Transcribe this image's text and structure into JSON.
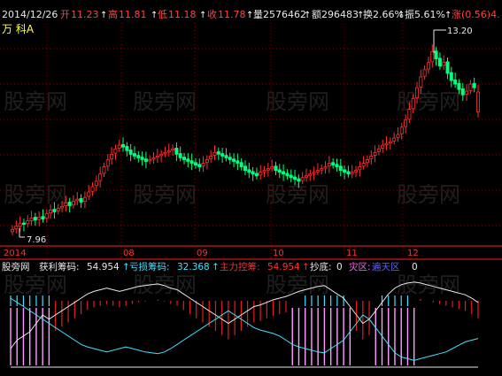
{
  "header": {
    "date": "2014/12/26",
    "open_label": "开",
    "open_value": "11.23",
    "high_label": "高",
    "high_value": "11.81",
    "low_label": "低",
    "low_value": "11.18",
    "close_label": "收",
    "close_value": "11.78",
    "volume_label": "量",
    "volume_value": "2576462",
    "amount_label": "额",
    "amount_value": "296483",
    "turnover_label": "换",
    "turnover_value": "2.66%",
    "amplitude_label": "振",
    "amplitude_value": "5.61%",
    "change_label": "涨",
    "change_value": "(0.56)4."
  },
  "stock_tag": "万  科A",
  "watermark": "股旁网",
  "indicator": {
    "name": "股旁网",
    "profit_label": "获利筹码:",
    "profit_value": "54.954",
    "loss_label": "亏损筹码:",
    "loss_value": "32.368",
    "main_label": "主力控筹:",
    "main_value": "54.954",
    "bottom_label": "抄底:",
    "bottom_value": "0",
    "disaster_label": "灾区:",
    "disaster_value": "遍天区",
    "last_value": "0"
  },
  "colors": {
    "up": "#ff3030",
    "down": "#00ff80",
    "grid": "#8b0000",
    "axis": "#ff2020"
  },
  "chart_data": [
    {
      "type": "candlestick",
      "title": "",
      "x_ticks": [
        "2014",
        "08",
        "09",
        "10",
        "11",
        "12"
      ],
      "max_label": "13.20",
      "min_label": "7.96",
      "ylim": [
        7.6,
        13.6
      ],
      "closes": [
        7.96,
        8.05,
        8.12,
        8.1,
        8.2,
        8.28,
        8.22,
        8.3,
        8.25,
        8.4,
        8.5,
        8.45,
        8.55,
        8.6,
        8.7,
        8.62,
        8.75,
        8.8,
        8.72,
        8.85,
        9.0,
        9.15,
        9.3,
        9.5,
        9.7,
        9.9,
        10.05,
        10.2,
        10.3,
        10.25,
        10.15,
        10.05,
        10.0,
        9.95,
        9.9,
        9.85,
        9.9,
        9.95,
        10.0,
        10.05,
        10.1,
        10.15,
        10.2,
        10.05,
        9.95,
        9.9,
        9.85,
        9.8,
        9.75,
        9.7,
        9.8,
        9.9,
        10.0,
        10.1,
        10.05,
        10.0,
        9.95,
        9.9,
        9.85,
        9.8,
        9.7,
        9.6,
        9.55,
        9.5,
        9.45,
        9.55,
        9.6,
        9.65,
        9.7,
        9.6,
        9.55,
        9.5,
        9.45,
        9.4,
        9.35,
        9.3,
        9.4,
        9.45,
        9.5,
        9.55,
        9.6,
        9.65,
        9.7,
        9.8,
        9.75,
        9.7,
        9.6,
        9.55,
        9.5,
        9.55,
        9.6,
        9.7,
        9.8,
        9.9,
        10.0,
        10.1,
        10.2,
        10.3,
        10.35,
        10.4,
        10.5,
        10.6,
        10.8,
        11.0,
        11.3,
        11.6,
        11.9,
        12.2,
        12.4,
        12.6,
        12.9,
        12.7,
        12.5,
        12.6,
        12.3,
        12.1,
        12.0,
        11.85,
        11.7,
        11.8,
        12.0,
        11.9,
        11.78
      ],
      "opens": [
        7.9,
        7.98,
        8.05,
        8.14,
        8.12,
        8.2,
        8.3,
        8.24,
        8.32,
        8.28,
        8.42,
        8.52,
        8.48,
        8.56,
        8.62,
        8.72,
        8.64,
        8.76,
        8.82,
        8.74,
        8.88,
        9.02,
        9.18,
        9.32,
        9.52,
        9.72,
        9.92,
        10.08,
        10.22,
        10.32,
        10.27,
        10.17,
        10.07,
        10.02,
        9.97,
        9.92,
        9.87,
        9.92,
        9.97,
        10.02,
        10.07,
        10.12,
        10.17,
        10.22,
        10.07,
        9.97,
        9.92,
        9.87,
        9.82,
        9.77,
        9.72,
        9.82,
        9.92,
        10.02,
        10.12,
        10.07,
        10.02,
        9.97,
        9.92,
        9.87,
        9.82,
        9.72,
        9.62,
        9.57,
        9.52,
        9.47,
        9.57,
        9.62,
        9.67,
        9.72,
        9.62,
        9.57,
        9.52,
        9.47,
        9.42,
        9.37,
        9.32,
        9.42,
        9.47,
        9.52,
        9.57,
        9.62,
        9.67,
        9.72,
        9.82,
        9.77,
        9.72,
        9.62,
        9.57,
        9.52,
        9.57,
        9.62,
        9.72,
        9.82,
        9.92,
        10.02,
        10.12,
        10.22,
        10.32,
        10.37,
        10.42,
        10.52,
        10.62,
        10.82,
        11.02,
        11.32,
        11.62,
        11.92,
        12.22,
        12.42,
        12.62,
        12.92,
        12.72,
        12.52,
        12.62,
        12.32,
        12.12,
        12.02,
        11.87,
        11.72,
        11.82,
        12.02,
        11.23
      ]
    },
    {
      "type": "indicator",
      "series": [
        {
          "name": "获利筹码",
          "values": [
            0.2,
            0.3,
            0.35,
            0.4,
            0.5,
            0.6,
            0.55,
            0.6,
            0.65,
            0.7,
            0.75,
            0.8,
            0.85,
            0.88,
            0.9,
            0.92,
            0.9,
            0.88,
            0.9,
            0.92,
            0.94,
            0.95,
            0.96,
            0.97,
            0.95,
            0.92,
            0.9,
            0.85,
            0.8,
            0.75,
            0.7,
            0.65,
            0.6,
            0.55,
            0.5,
            0.55,
            0.6,
            0.65,
            0.7,
            0.72,
            0.75,
            0.78,
            0.8,
            0.82,
            0.85,
            0.88,
            0.9,
            0.92,
            0.94,
            0.95,
            0.9,
            0.85,
            0.8,
            0.7,
            0.6,
            0.5,
            0.55,
            0.65,
            0.75,
            0.85,
            0.92,
            0.96,
            0.98,
            0.99,
            0.98,
            0.96,
            0.94,
            0.92,
            0.9,
            0.88,
            0.86,
            0.84,
            0.8,
            0.75
          ]
        },
        {
          "name": "亏损筹码",
          "values": [
            0.8,
            0.75,
            0.7,
            0.65,
            0.6,
            0.55,
            0.5,
            0.45,
            0.4,
            0.35,
            0.3,
            0.25,
            0.22,
            0.2,
            0.18,
            0.16,
            0.18,
            0.2,
            0.22,
            0.2,
            0.18,
            0.16,
            0.15,
            0.14,
            0.16,
            0.2,
            0.25,
            0.3,
            0.35,
            0.4,
            0.45,
            0.5,
            0.55,
            0.6,
            0.65,
            0.6,
            0.55,
            0.5,
            0.45,
            0.42,
            0.4,
            0.38,
            0.35,
            0.3,
            0.25,
            0.22,
            0.2,
            0.18,
            0.16,
            0.15,
            0.2,
            0.25,
            0.3,
            0.4,
            0.5,
            0.6,
            0.55,
            0.45,
            0.35,
            0.25,
            0.15,
            0.1,
            0.08,
            0.06,
            0.08,
            0.1,
            0.12,
            0.14,
            0.16,
            0.2,
            0.24,
            0.28,
            0.3,
            0.32
          ]
        }
      ]
    }
  ]
}
